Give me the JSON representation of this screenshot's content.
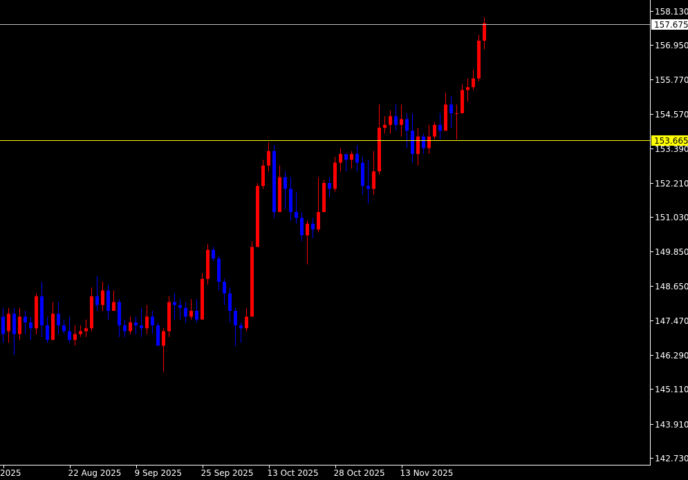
{
  "chart_data": {
    "type": "candlestick",
    "colors": {
      "background": "#000000",
      "axis": "#ffffff",
      "bullish": "#ff0000",
      "bearish": "#0000ff",
      "current_price_line": "#ffff00",
      "high_price_line": "#c0c0c0",
      "current_price_tag": "#ffff00",
      "high_price_tag": "#ffffff"
    },
    "y_range": [
      142.5,
      158.5
    ],
    "y_ticks": [
      "158.130",
      "156.950",
      "155.770",
      "154.570",
      "153.390",
      "152.210",
      "151.030",
      "149.850",
      "148.650",
      "147.470",
      "146.290",
      "145.110",
      "143.910",
      "142.730"
    ],
    "x_ticks": [
      {
        "label": "2025",
        "bar": 0
      },
      {
        "label": "22 Aug 2025",
        "bar": 12
      },
      {
        "label": "9 Sep 2025",
        "bar": 24
      },
      {
        "label": "25 Sep 2025",
        "bar": 36
      },
      {
        "label": "13 Oct 2025",
        "bar": 48
      },
      {
        "label": "28 Oct 2025",
        "bar": 60
      },
      {
        "label": "13 Nov 2025",
        "bar": 72
      }
    ],
    "reference_lines": [
      {
        "name": "high",
        "value": 157.675,
        "label": "157.675"
      },
      {
        "name": "current",
        "value": 153.665,
        "label": "153.665"
      }
    ],
    "candles": [
      [
        147.6,
        147.0,
        146.7,
        147.9
      ],
      [
        147.1,
        147.7,
        146.7,
        147.9
      ],
      [
        147.7,
        147.0,
        146.3,
        147.9
      ],
      [
        147.0,
        147.6,
        146.8,
        147.9
      ],
      [
        147.6,
        147.4,
        147.0,
        147.8
      ],
      [
        147.4,
        147.2,
        146.8,
        147.6
      ],
      [
        147.2,
        148.3,
        147.0,
        148.4
      ],
      [
        148.3,
        147.3,
        146.9,
        148.8
      ],
      [
        147.3,
        146.8,
        146.7,
        147.6
      ],
      [
        146.8,
        147.7,
        146.8,
        148.1
      ],
      [
        147.7,
        147.3,
        147.0,
        148.1
      ],
      [
        147.3,
        147.1,
        147.0,
        147.5
      ],
      [
        147.1,
        146.8,
        146.7,
        147.6
      ],
      [
        146.8,
        147.0,
        146.6,
        147.3
      ],
      [
        147.0,
        147.1,
        146.9,
        147.3
      ],
      [
        147.1,
        147.2,
        146.9,
        147.5
      ],
      [
        147.2,
        148.3,
        147.1,
        148.6
      ],
      [
        148.3,
        148.0,
        147.8,
        149.0
      ],
      [
        148.0,
        148.5,
        147.8,
        148.8
      ],
      [
        148.5,
        147.8,
        147.5,
        148.7
      ],
      [
        147.8,
        148.1,
        147.8,
        148.5
      ],
      [
        148.1,
        147.3,
        146.9,
        148.2
      ],
      [
        147.3,
        147.1,
        146.9,
        147.5
      ],
      [
        147.1,
        147.4,
        147.0,
        147.6
      ],
      [
        147.4,
        147.3,
        147.0,
        147.6
      ],
      [
        147.3,
        147.2,
        146.9,
        147.9
      ],
      [
        147.2,
        147.6,
        147.0,
        148.0
      ],
      [
        147.6,
        147.3,
        147.0,
        147.8
      ],
      [
        147.3,
        146.6,
        146.6,
        147.4
      ],
      [
        146.6,
        147.1,
        145.7,
        147.2
      ],
      [
        147.1,
        148.1,
        146.9,
        148.3
      ],
      [
        148.1,
        148.0,
        147.5,
        148.4
      ],
      [
        148.0,
        147.9,
        147.5,
        148.2
      ],
      [
        147.9,
        147.6,
        147.4,
        148.1
      ],
      [
        147.6,
        147.8,
        147.5,
        148.2
      ],
      [
        147.8,
        147.5,
        147.4,
        148.2
      ],
      [
        147.5,
        148.9,
        147.8,
        149.1
      ],
      [
        148.9,
        149.9,
        148.7,
        150.1
      ],
      [
        149.9,
        149.6,
        149.5,
        150.0
      ],
      [
        149.6,
        148.8,
        148.5,
        149.7
      ],
      [
        148.8,
        148.4,
        148.0,
        148.9
      ],
      [
        148.4,
        147.8,
        147.4,
        148.6
      ],
      [
        147.8,
        147.3,
        146.6,
        147.9
      ],
      [
        147.3,
        147.2,
        146.7,
        147.4
      ],
      [
        147.2,
        147.6,
        147.1,
        147.9
      ],
      [
        147.6,
        150.0,
        149.2,
        150.2
      ],
      [
        150.0,
        152.1,
        150.0,
        152.2
      ],
      [
        152.1,
        152.8,
        152.0,
        153.0
      ],
      [
        152.8,
        153.3,
        152.6,
        153.6
      ],
      [
        153.3,
        151.2,
        151.0,
        153.5
      ],
      [
        151.2,
        152.4,
        151.5,
        152.8
      ],
      [
        152.4,
        152.0,
        151.3,
        152.6
      ],
      [
        152.0,
        151.2,
        150.9,
        152.4
      ],
      [
        151.2,
        151.0,
        150.8,
        151.9
      ],
      [
        151.0,
        150.4,
        150.2,
        151.2
      ],
      [
        150.4,
        150.8,
        149.4,
        150.9
      ],
      [
        150.8,
        150.6,
        150.3,
        151.0
      ],
      [
        150.6,
        151.2,
        150.5,
        152.4
      ],
      [
        151.2,
        152.2,
        151.9,
        152.3
      ],
      [
        152.2,
        152.0,
        151.7,
        152.4
      ],
      [
        152.0,
        152.9,
        151.9,
        153.1
      ],
      [
        152.9,
        153.2,
        152.6,
        153.4
      ],
      [
        153.2,
        153.0,
        152.6,
        153.1
      ],
      [
        153.0,
        153.2,
        152.7,
        153.3
      ],
      [
        153.2,
        152.9,
        152.6,
        153.5
      ],
      [
        152.9,
        152.1,
        151.8,
        153.1
      ],
      [
        152.1,
        152.0,
        151.5,
        153.0
      ],
      [
        152.0,
        152.6,
        151.8,
        153.3
      ],
      [
        152.6,
        154.1,
        152.5,
        154.9
      ],
      [
        154.1,
        154.2,
        153.9,
        154.5
      ],
      [
        154.2,
        154.5,
        153.9,
        154.7
      ],
      [
        154.5,
        154.2,
        154.0,
        154.9
      ],
      [
        154.2,
        154.4,
        153.8,
        154.9
      ],
      [
        154.4,
        154.0,
        153.4,
        154.6
      ],
      [
        154.0,
        153.2,
        152.9,
        154.6
      ],
      [
        153.2,
        153.8,
        152.8,
        154.1
      ],
      [
        153.8,
        153.4,
        153.2,
        153.9
      ],
      [
        153.4,
        153.8,
        153.2,
        154.2
      ],
      [
        153.8,
        154.2,
        153.7,
        154.3
      ],
      [
        154.2,
        154.0,
        153.7,
        154.6
      ],
      [
        154.0,
        154.9,
        154.1,
        155.3
      ],
      [
        154.9,
        154.6,
        154.1,
        155.2
      ],
      [
        154.6,
        154.6,
        153.7,
        154.9
      ],
      [
        154.6,
        155.4,
        154.7,
        155.6
      ],
      [
        155.4,
        155.5,
        155.0,
        155.8
      ],
      [
        155.5,
        155.8,
        155.4,
        156.1
      ],
      [
        155.8,
        157.1,
        155.7,
        157.3
      ],
      [
        157.1,
        157.7,
        156.8,
        157.9
      ]
    ]
  }
}
